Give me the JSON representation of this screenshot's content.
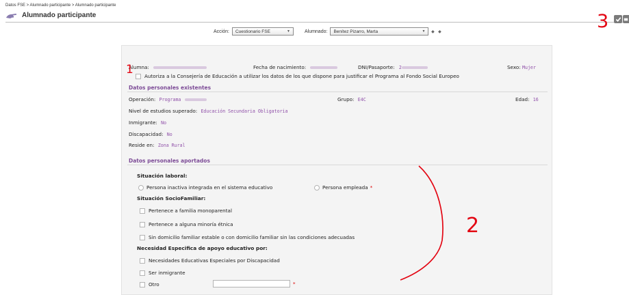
{
  "breadcrumb": "Datos FSE > Alumnado participante > Alumnado participante",
  "page_title": "Alumnado participante",
  "filters": {
    "accion_label": "Acción:",
    "accion_value": "Cuestionario FSE",
    "alumnado_label": "Alumnado:",
    "alumnado_value": "Benítez Pizarro, Marta"
  },
  "student": {
    "alumna_label": "Alumna:",
    "fecha_label": "Fecha de nacimiento:",
    "dni_label": "DNI/Pasaporte:",
    "dni_prefix": "2",
    "sexo_label": "Sexo:",
    "sexo_value": "Mujer"
  },
  "authorization_text": "Autoriza a la Consejería de Educación a utilizar los datos de los que dispone para justificar el Programa al Fondo Social Europeo",
  "existing": {
    "title": "Datos personales existentes",
    "operacion_label": "Operación:",
    "operacion_value": "Programa",
    "grupo_label": "Grupo:",
    "grupo_value": "E4C",
    "edad_label": "Edad:",
    "edad_value": "16",
    "nivel_label": "Nivel de estudios superado:",
    "nivel_value": "Educación Secundaria Obligatoria",
    "inmigrante_label": "Inmigrante:",
    "inmigrante_value": "No",
    "discapacidad_label": "Discapacidad:",
    "discapacidad_value": "No",
    "reside_label": "Reside en:",
    "reside_value": "Zona Rural"
  },
  "provided": {
    "title": "Datos personales aportados",
    "laboral_title": "Situación laboral:",
    "laboral_options": [
      "Persona inactiva integrada en el sistema educativo",
      "Persona empleada"
    ],
    "socio_title": "Situación SocioFamiliar:",
    "socio_options": [
      "Pertenece a familia monoparental",
      "Pertenece a alguna minoría étnica",
      "Sin domicilio familiar estable o con domicilio familiar sin las condiciones adecuadas"
    ],
    "necesidad_title": "Necesidad Especifica de apoyo educativo por:",
    "necesidad_options": [
      "Necesidades Educativas Especiales por Discapacidad",
      "Ser inmigrante",
      "Otro"
    ],
    "required_mark": "*"
  },
  "annotations": {
    "one": "1",
    "two": "2",
    "three": "3"
  },
  "colors": {
    "accent": "#7d4c97",
    "value": "#8f4fa8",
    "required": "#dd0000",
    "annotation": "#e30613"
  }
}
